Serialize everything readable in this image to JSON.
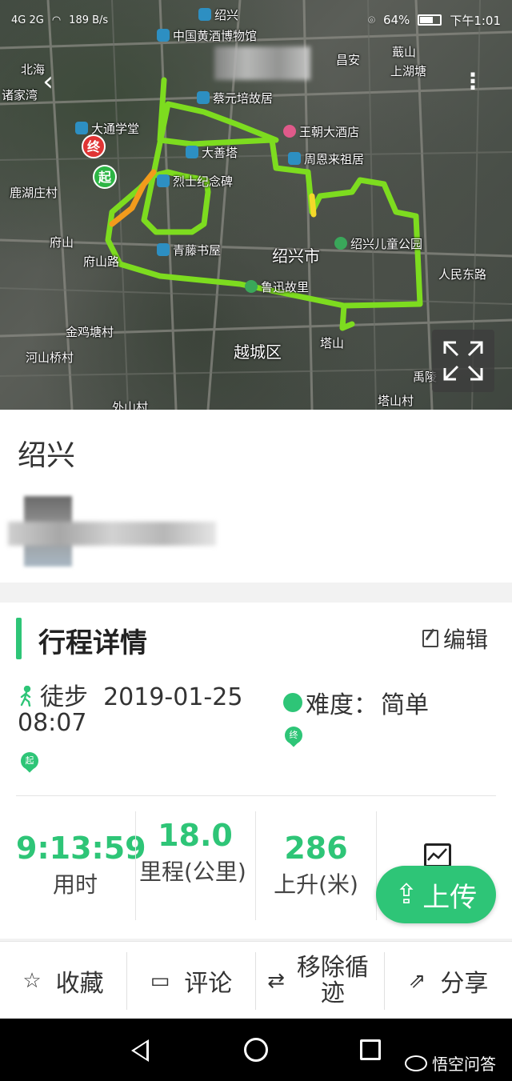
{
  "status": {
    "net": "4G 2G",
    "speed": "189\nB/s",
    "battery": "64%",
    "time": "下午1:01"
  },
  "map": {
    "labels": [
      {
        "text": "绍兴",
        "style": "blue"
      },
      {
        "text": "中国黄酒博物馆",
        "style": "blue"
      },
      {
        "text": "北海",
        "style": ""
      },
      {
        "text": "诸家湾",
        "style": ""
      },
      {
        "text": "蔡元培故居",
        "style": "blue"
      },
      {
        "text": "昌安",
        "style": ""
      },
      {
        "text": "蕺山",
        "style": ""
      },
      {
        "text": "上湖塘",
        "style": ""
      },
      {
        "text": "大通学堂",
        "style": "blue"
      },
      {
        "text": "王朝大酒店",
        "style": "pink"
      },
      {
        "text": "周恩来祖居",
        "style": "blue"
      },
      {
        "text": "大善塔",
        "style": "blue"
      },
      {
        "text": "烈士纪念碑",
        "style": "blue"
      },
      {
        "text": "鹿湖庄村",
        "style": ""
      },
      {
        "text": "府山",
        "style": ""
      },
      {
        "text": "府山路",
        "style": ""
      },
      {
        "text": "青藤书屋",
        "style": "blue"
      },
      {
        "text": "绍兴市",
        "style": "big"
      },
      {
        "text": "绍兴儿童公园",
        "style": "green"
      },
      {
        "text": "人民东路",
        "style": ""
      },
      {
        "text": "鲁迅故里",
        "style": "green"
      },
      {
        "text": "金鸡塘村",
        "style": ""
      },
      {
        "text": "河山桥村",
        "style": ""
      },
      {
        "text": "越城区",
        "style": "big"
      },
      {
        "text": "塔山",
        "style": ""
      },
      {
        "text": "禹陵",
        "style": ""
      },
      {
        "text": "塔山村",
        "style": ""
      },
      {
        "text": "外山村",
        "style": ""
      }
    ],
    "start_marker": "起",
    "end_marker": "终"
  },
  "title": {
    "place": "绍兴"
  },
  "trip": {
    "section_title": "行程详情",
    "edit_label": "编辑",
    "mode": "徒步",
    "datetime": "2019-01-25 08:07",
    "difficulty_label": "难度：",
    "difficulty_value": "简单",
    "start_pin": "起",
    "end_pin": "终"
  },
  "stats": [
    {
      "value": "9:13:59",
      "label": "用时"
    },
    {
      "value": "18.0",
      "label": "里程(公里)"
    },
    {
      "value": "286",
      "label": "上升(米)"
    }
  ],
  "upload_label": "上传",
  "actions": [
    {
      "icon": "☆",
      "label": "收藏"
    },
    {
      "icon": "▭",
      "label": "评论"
    },
    {
      "icon": "⇄",
      "label": "移除循迹"
    },
    {
      "icon": "⇗",
      "label": "分享"
    }
  ],
  "watermark": "悟空问答",
  "colors": {
    "accent": "#2ec577",
    "track_green": "#7ddc1f",
    "track_orange": "#f29b1c",
    "end_red": "#e03434"
  }
}
